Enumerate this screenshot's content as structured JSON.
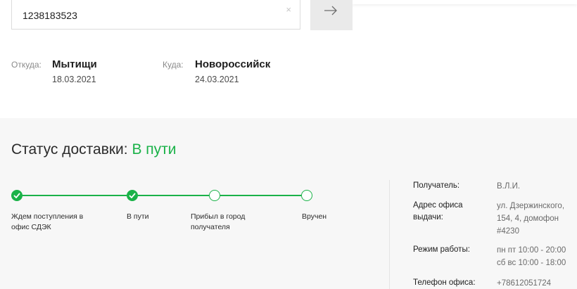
{
  "tracking": {
    "value": "1238183523",
    "clear_symbol": "×",
    "submit_icon": "arrow-right-icon"
  },
  "route": {
    "from_label": "Откуда:",
    "from_city": "Мытищи",
    "from_date": "18.03.2021",
    "to_label": "Куда:",
    "to_city": "Новороссийск",
    "to_date": "24.03.2021"
  },
  "status": {
    "title_prefix": "Статус доставки:",
    "title_value": "В пути",
    "accent_color": "#1ab248",
    "steps": [
      {
        "label": "Ждем поступления в офис СДЭК",
        "done": true
      },
      {
        "label": "В пути",
        "done": true
      },
      {
        "label": "Прибыл в город получателя",
        "done": false
      },
      {
        "label": "Вручен",
        "done": false
      }
    ]
  },
  "details": {
    "recipient_label": "Получатель:",
    "recipient_value": "В.Л.И.",
    "office_address_label": "Адрес офиса выдачи:",
    "office_address_value": "ул. Дзержинского, 154, 4, домофон #4230",
    "hours_label": "Режим работы:",
    "hours_value_1": "пн пт 10:00 - 20:00",
    "hours_value_2": "сб вс 10:00 - 18:00",
    "phone_label": "Телефон офиса:",
    "phone_value": "+78612051724"
  }
}
